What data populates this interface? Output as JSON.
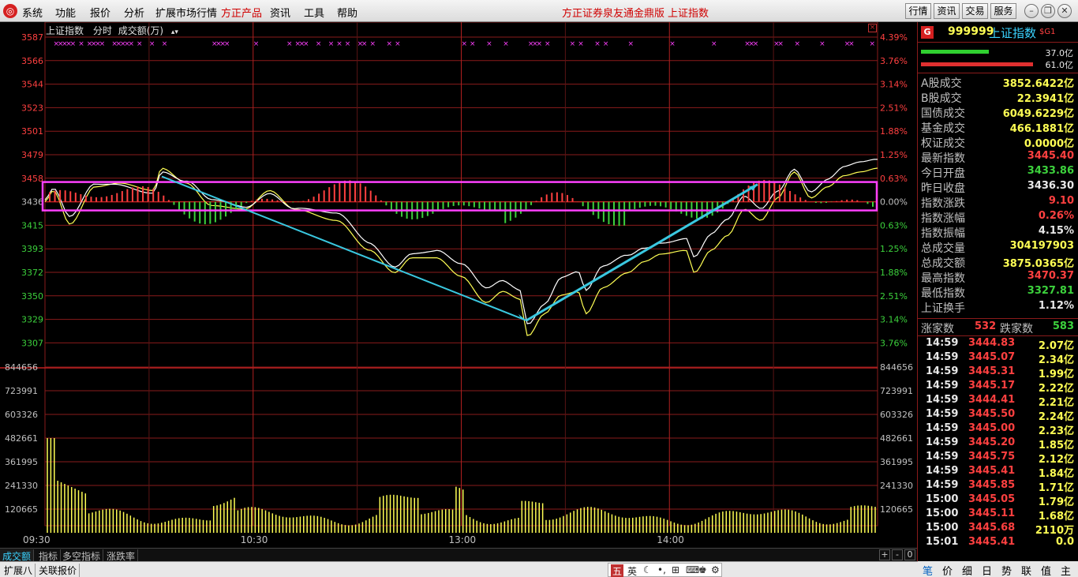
{
  "menu": {
    "items": [
      "系统",
      "功能",
      "报价",
      "分析",
      "扩展市场行情",
      "方正产品",
      "资讯",
      "工具",
      "帮助"
    ],
    "center_title": "方正证券泉友通金鼎版",
    "center_index": "上证指数",
    "right_buttons": [
      "行情",
      "资讯",
      "交易",
      "服务"
    ]
  },
  "chart_header": {
    "name": "上证指数",
    "mode": "分时",
    "indicator": "成交额(万)",
    "arrows": "▴▾"
  },
  "price_axis_left": [
    "3587",
    "3566",
    "3544",
    "3523",
    "3501",
    "3479",
    "3458",
    "3436",
    "3415",
    "3393",
    "3372",
    "3350",
    "3329",
    "3307"
  ],
  "pct_axis_right": [
    "4.39%",
    "3.76%",
    "3.14%",
    "2.51%",
    "1.88%",
    "1.25%",
    "0.63%",
    "0.00%",
    "0.63%",
    "1.25%",
    "1.88%",
    "2.51%",
    "3.14%",
    "3.76%"
  ],
  "vol_axis": [
    "844656",
    "723991",
    "603326",
    "482661",
    "361995",
    "241330",
    "120665"
  ],
  "time_axis": [
    "09:30",
    "10:30",
    "13:00",
    "14:00"
  ],
  "bottom_tabs": [
    "成交额",
    "指标",
    "多空指标",
    "涨跌率"
  ],
  "bottom_buttons": [
    "+",
    "-",
    "0"
  ],
  "status_tabs": [
    "扩展八",
    "关联报价"
  ],
  "ime": [
    "五",
    "英",
    "☾",
    "•,",
    "⊞",
    "⌨",
    "♚",
    "⚙"
  ],
  "panel": {
    "code": "999999",
    "name": "上证指数",
    "tag": "$G1",
    "g_icon": "G",
    "bar_up_label": "37.0亿",
    "bar_down_label": "61.0亿",
    "stats": [
      {
        "label": "A股成交",
        "value": "3852.6422亿",
        "color": "yellow"
      },
      {
        "label": "B股成交",
        "value": "22.3941亿",
        "color": "yellow"
      },
      {
        "label": "国债成交",
        "value": "6049.6229亿",
        "color": "yellow"
      },
      {
        "label": "基金成交",
        "value": "466.1881亿",
        "color": "yellow"
      },
      {
        "label": "权证成交",
        "value": "0.0000亿",
        "color": "yellow"
      },
      {
        "label": "最新指数",
        "value": "3445.40",
        "color": "red"
      },
      {
        "label": "今日开盘",
        "value": "3433.86",
        "color": "green"
      },
      {
        "label": "昨日收盘",
        "value": "3436.30",
        "color": "white"
      },
      {
        "label": "指数涨跌",
        "value": "9.10",
        "color": "red"
      },
      {
        "label": "指数涨幅",
        "value": "0.26%",
        "color": "red"
      },
      {
        "label": "指数振幅",
        "value": "4.15%",
        "color": "white"
      },
      {
        "label": "总成交量",
        "value": "304197903",
        "color": "yellow"
      },
      {
        "label": "总成交额",
        "value": "3875.0365亿",
        "color": "yellow"
      },
      {
        "label": "最高指数",
        "value": "3470.37",
        "color": "red"
      },
      {
        "label": "最低指数",
        "value": "3327.81",
        "color": "green"
      },
      {
        "label": "上证换手",
        "value": "1.12%",
        "color": "white"
      }
    ],
    "up_label": "涨家数",
    "up_count": "532",
    "down_label": "跌家数",
    "down_count": "583",
    "ticks": [
      {
        "time": "14:59",
        "price": "3444.83",
        "vol": "2.07亿"
      },
      {
        "time": "14:59",
        "price": "3445.07",
        "vol": "2.34亿"
      },
      {
        "time": "14:59",
        "price": "3445.31",
        "vol": "1.99亿"
      },
      {
        "time": "14:59",
        "price": "3445.17",
        "vol": "2.22亿"
      },
      {
        "time": "14:59",
        "price": "3444.41",
        "vol": "2.21亿"
      },
      {
        "time": "14:59",
        "price": "3445.50",
        "vol": "2.24亿"
      },
      {
        "time": "14:59",
        "price": "3445.00",
        "vol": "2.23亿"
      },
      {
        "time": "14:59",
        "price": "3445.20",
        "vol": "1.85亿"
      },
      {
        "time": "14:59",
        "price": "3445.75",
        "vol": "2.12亿"
      },
      {
        "time": "14:59",
        "price": "3445.41",
        "vol": "1.84亿"
      },
      {
        "time": "14:59",
        "price": "3445.85",
        "vol": "1.71亿"
      },
      {
        "time": "15:00",
        "price": "3445.05",
        "vol": "1.79亿"
      },
      {
        "time": "15:00",
        "price": "3445.11",
        "vol": "1.68亿"
      },
      {
        "time": "15:00",
        "price": "3445.68",
        "vol": "2110万"
      },
      {
        "time": "15:01",
        "price": "3445.41",
        "vol": "0.0"
      }
    ],
    "tabs": [
      "笔",
      "价",
      "细",
      "日",
      "势",
      "联",
      "值",
      "主"
    ]
  },
  "colors": {
    "up": "#ff4040",
    "down": "#3cd13c",
    "grid": "#8a1b1b",
    "price_line": "#ffffff",
    "avg_line": "#ffff54",
    "annotation": "#3ac8e0",
    "box": "#ff40ff"
  }
}
